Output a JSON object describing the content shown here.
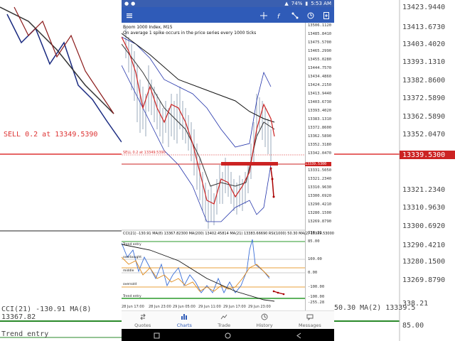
{
  "status": {
    "time": "5:53 AM",
    "battery": "74%"
  },
  "chart": {
    "symbol_title": "Boom 1000 Index, M15",
    "description": "On average 1 spike occurs in the price series every 1000 ticks",
    "sell_order_label": "SELL 0.2 at 13349.5390",
    "current_price": "13339.5300",
    "price_axis": [
      "13506.1120",
      "13485.8410",
      "13475.5700",
      "13465.2990",
      "13455.0280",
      "13444.7570",
      "13434.4860",
      "13424.2150",
      "13413.9440",
      "13403.6730",
      "13393.4020",
      "13383.1310",
      "13372.8600",
      "13362.5890",
      "13352.3180",
      "13342.0470",
      "13331.5050",
      "13321.2340",
      "13310.9630",
      "13300.6920",
      "13290.4210",
      "13280.1500",
      "13269.8790"
    ],
    "oscillator_title": "CCI(21) -130.91 MA(8) 13367.82300 MA(200) 13402.45814 MA(21) 13383.66690 RSI(1000) 50.30 MA(2) 13339.53000",
    "oscillator_axis": [
      "338.21",
      "85.00",
      "100.00",
      "0.00",
      "-100.00",
      "-100.00",
      "-255.28"
    ],
    "osc_labels": [
      "Trend entry",
      "overbought",
      "middle",
      "oversold",
      "Trend entry"
    ],
    "time_axis": [
      "28 Jun 17:00",
      "28 Jun 23:00",
      "29 Jun 05:00",
      "29 Jun 11:00",
      "29 Jun 17:00",
      "29 Jun 23:00"
    ]
  },
  "left_bg": {
    "sell_label": "SELL 0.2 at 13349.5390",
    "cci_label": "CCI(21) -130.91 MA(8) 13367.82",
    "trend_label": "Trend entry"
  },
  "right_bg": {
    "prices": [
      "13423.9440",
      "13413.6730",
      "13403.4020",
      "13393.1310",
      "13382.8600",
      "13372.5890",
      "13362.5890",
      "13352.0470",
      "13339.5300",
      "13321.2340",
      "13310.9630",
      "13300.6920",
      "13290.4210",
      "13280.1500",
      "13269.8790"
    ],
    "osc_bottom": [
      "50.30 MA(2) 13339.5",
      "338.21",
      "85.00"
    ]
  },
  "nav": {
    "quotes": "Quotes",
    "charts": "Charts",
    "trade": "Trade",
    "history": "History",
    "messages": "Messages"
  }
}
